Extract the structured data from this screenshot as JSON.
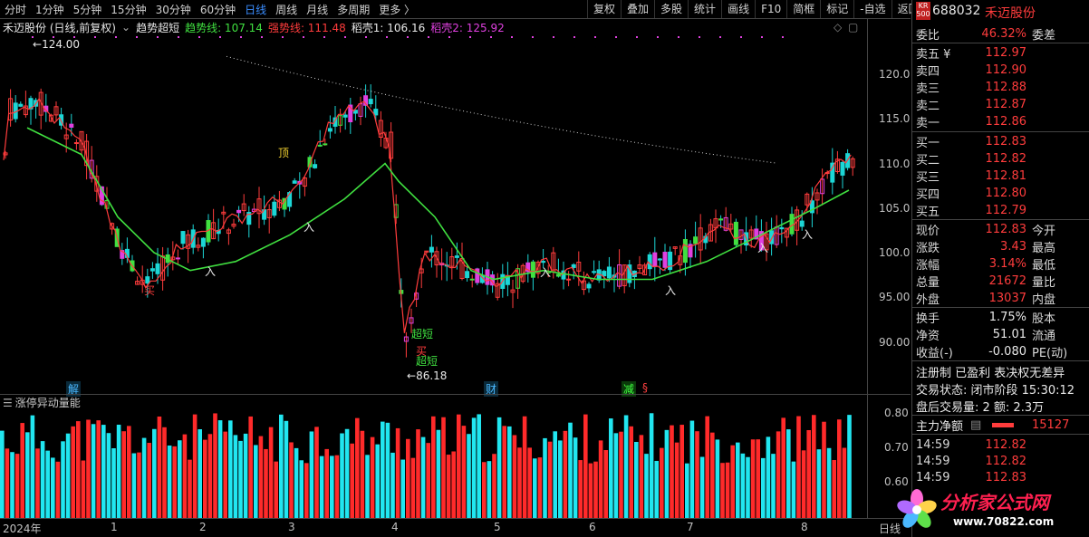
{
  "periods": [
    "分时",
    "1分钟",
    "5分钟",
    "15分钟",
    "30分钟",
    "60分钟",
    "日线",
    "周线",
    "月线",
    "多周期",
    "更多 〉"
  ],
  "active_period": 6,
  "toolbar": [
    "复权",
    "叠加",
    "多股",
    "统计",
    "画线",
    "F10",
    "简框",
    "标记",
    "-自选",
    "返回"
  ],
  "header": {
    "title": "禾迈股份 (日线,前复权)",
    "indicator": "趋势超短",
    "trend_line": "趋势线: 107.14",
    "strong_line": "强势线: 111.48",
    "shell1": "稻壳1: 106.16",
    "shell2": "稻壳2: 125.92"
  },
  "price_axis": [
    "120.0",
    "115.0",
    "110.0",
    "105.0",
    "100.0",
    "95.00",
    "90.00"
  ],
  "high_label": "124.00",
  "low_label": "86.18",
  "annotations": {
    "top": "顶",
    "buy": "买",
    "in": "入",
    "super_short": "超短"
  },
  "event_badges": [
    {
      "text": "解",
      "color": "#4ab8ff"
    },
    {
      "text": "财",
      "color": "#4ab8ff"
    },
    {
      "text": "减",
      "color": "#40ff40"
    },
    {
      "text": "§",
      "color": "#ff4040"
    }
  ],
  "sub_indicator": "涨停异动量能",
  "vol_axis": [
    "0.80",
    "0.70",
    "0.60"
  ],
  "date_axis": [
    "2024年",
    "1",
    "2",
    "3",
    "4",
    "5",
    "6",
    "7",
    "8"
  ],
  "date_axis_right": "日线",
  "quote": {
    "market_tag": "KR",
    "market_sub": "500",
    "code": "688032",
    "name": "禾迈股份",
    "wei_bi_label": "委比",
    "wei_bi": "46.32%",
    "wei_cha_label": "委差",
    "asks": [
      {
        "label": "卖五 ¥",
        "price": "112.97"
      },
      {
        "label": "卖四",
        "price": "112.90"
      },
      {
        "label": "卖三",
        "price": "112.88"
      },
      {
        "label": "卖二",
        "price": "112.87"
      },
      {
        "label": "卖一",
        "price": "112.86"
      }
    ],
    "bids": [
      {
        "label": "买一",
        "price": "112.83"
      },
      {
        "label": "买二",
        "price": "112.82"
      },
      {
        "label": "买三",
        "price": "112.81"
      },
      {
        "label": "买四",
        "price": "112.80"
      },
      {
        "label": "买五",
        "price": "112.79"
      }
    ],
    "stats": [
      {
        "l": "现价",
        "v": "112.83",
        "r": "今开"
      },
      {
        "l": "涨跌",
        "v": "3.43",
        "r": "最高"
      },
      {
        "l": "涨幅",
        "v": "3.14%",
        "r": "最低"
      },
      {
        "l": "总量",
        "v": "21672",
        "r": "量比"
      },
      {
        "l": "外盘",
        "v": "13037",
        "r": "内盘"
      }
    ],
    "stats2": [
      {
        "l": "换手",
        "v": "1.75%",
        "r": "股本"
      },
      {
        "l": "净资",
        "v": "51.01",
        "r": "流通"
      },
      {
        "l": "收益(-)",
        "v": "-0.080",
        "r": "PE(动)"
      }
    ],
    "flags": "注册制 已盈利 表决权无差异",
    "trade_state": "交易状态: 闭市阶段 15:30:12",
    "after_hours": "盘后交易量: 2  额: 2.3万",
    "main_flow_label": "主力净额",
    "main_flow_value": "15127",
    "ticks": [
      {
        "t": "14:59",
        "p": "112.82"
      },
      {
        "t": "14:59",
        "p": "112.82"
      },
      {
        "t": "14:59",
        "p": "112.83"
      }
    ]
  },
  "watermark": {
    "line1": "分析家公式网",
    "line2": "www.70822.com"
  },
  "colors": {
    "up": "#ff3c3c",
    "down": "#1cd6d6",
    "green_line": "#40e040",
    "magenta": "#e040e0",
    "accent": "#3a8dff"
  }
}
